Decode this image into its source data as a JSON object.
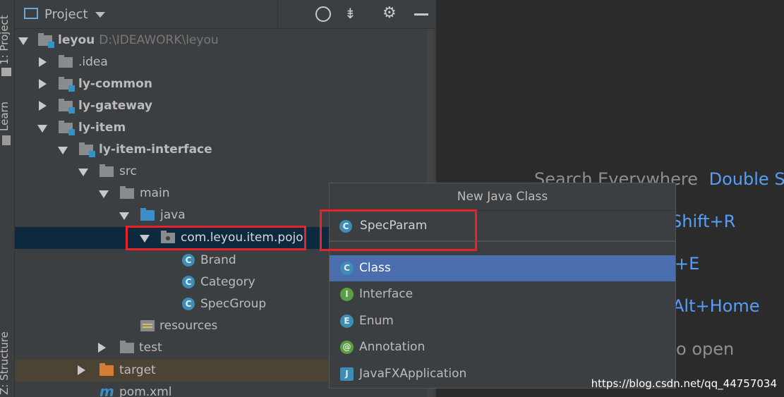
{
  "side_stripe": {
    "tabs": [
      "1: Project",
      "Learn",
      "Z: Structure"
    ]
  },
  "toolbar": {
    "title": "Project",
    "icons": [
      "project-view-icon",
      "dropdown-arrow-icon",
      "locate-icon",
      "collapse-all-icon",
      "gear-icon",
      "minimize-icon"
    ]
  },
  "tree": {
    "root": {
      "name": "leyou",
      "path": "D:\\IDEAWORK\\leyou"
    },
    "items": [
      {
        "label": ".idea"
      },
      {
        "label": "ly-common"
      },
      {
        "label": "ly-gateway"
      },
      {
        "label": "ly-item"
      },
      {
        "label": "ly-item-interface"
      },
      {
        "label": "src"
      },
      {
        "label": "main"
      },
      {
        "label": "java"
      },
      {
        "label": "com.leyou.item.pojo"
      },
      {
        "label": "Brand",
        "icon_letter": "C"
      },
      {
        "label": "Category",
        "icon_letter": "C"
      },
      {
        "label": "SpecGroup",
        "icon_letter": "C"
      },
      {
        "label": "resources"
      },
      {
        "label": "test"
      },
      {
        "label": "target"
      },
      {
        "label": "pom.xml",
        "icon_letter": "m"
      }
    ]
  },
  "welcome": {
    "search_label": "Search Everywhere",
    "search_key": "Double Sh",
    "line2_key": "Shift+R",
    "line3_key": "+E",
    "line4_key": "Alt+Home",
    "line5_text": "o open"
  },
  "popup": {
    "title": "New Java Class",
    "name_value": "SpecParam",
    "name_icon_letter": "C",
    "kinds": [
      {
        "label": "Class",
        "letter": "C",
        "color": "#3d8db4",
        "selected": true
      },
      {
        "label": "Interface",
        "letter": "I",
        "color": "#5a9f42",
        "selected": false
      },
      {
        "label": "Enum",
        "letter": "E",
        "color": "#3d8db4",
        "selected": false
      },
      {
        "label": "Annotation",
        "letter": "@",
        "color": "#5a9f42",
        "selected": false
      },
      {
        "label": "JavaFXApplication",
        "letter": "J",
        "color": "#3d8db4",
        "selected": false
      }
    ]
  },
  "watermark": "https://blog.csdn.net/qq_44757034"
}
